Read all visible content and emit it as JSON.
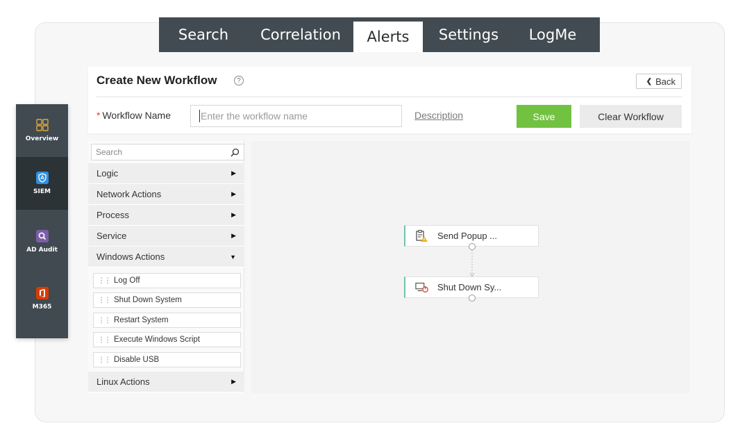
{
  "topnav": {
    "tabs": [
      {
        "label": "Search"
      },
      {
        "label": "Correlation"
      },
      {
        "label": "Alerts",
        "active": true
      },
      {
        "label": "Settings"
      },
      {
        "label": "LogMe"
      }
    ]
  },
  "sidebar": {
    "items": [
      {
        "label": "Overview",
        "icon": "grid-icon"
      },
      {
        "label": "SIEM",
        "icon": "shield-icon",
        "active": true
      },
      {
        "label": "AD Audit",
        "icon": "magnifier-icon",
        "color": "#7b5ea7"
      },
      {
        "label": "M365",
        "icon": "office-icon",
        "color": "#d83b01"
      }
    ]
  },
  "header": {
    "title": "Create New Workflow",
    "help_icon": "?",
    "back_label": "Back",
    "workflow_name_label": "Workflow Name",
    "required_mark": "*",
    "workflow_name_placeholder": "Enter the workflow name",
    "description_link": "Description",
    "save_label": "Save",
    "clear_label": "Clear Workflow"
  },
  "actions": {
    "search_placeholder": "Search",
    "categories": [
      {
        "label": "Logic",
        "expanded": false
      },
      {
        "label": "Network Actions",
        "expanded": false
      },
      {
        "label": "Process",
        "expanded": false
      },
      {
        "label": "Service",
        "expanded": false
      },
      {
        "label": "Windows Actions",
        "expanded": true
      },
      {
        "label": "Linux Actions",
        "expanded": false
      }
    ],
    "windows_items": [
      {
        "label": "Log Off"
      },
      {
        "label": "Shut Down System"
      },
      {
        "label": "Restart System"
      },
      {
        "label": "Execute Windows Script"
      },
      {
        "label": "Disable USB"
      }
    ]
  },
  "canvas": {
    "nodes": [
      {
        "label": "Send Popup ...",
        "icon": "clipboard-warning-icon"
      },
      {
        "label": "Shut Down Sy...",
        "icon": "monitor-power-icon"
      }
    ]
  },
  "colors": {
    "nav_bg": "#424b51",
    "save_green": "#72c241",
    "node_accent": "#71c1ae",
    "required_red": "#e0432b"
  }
}
